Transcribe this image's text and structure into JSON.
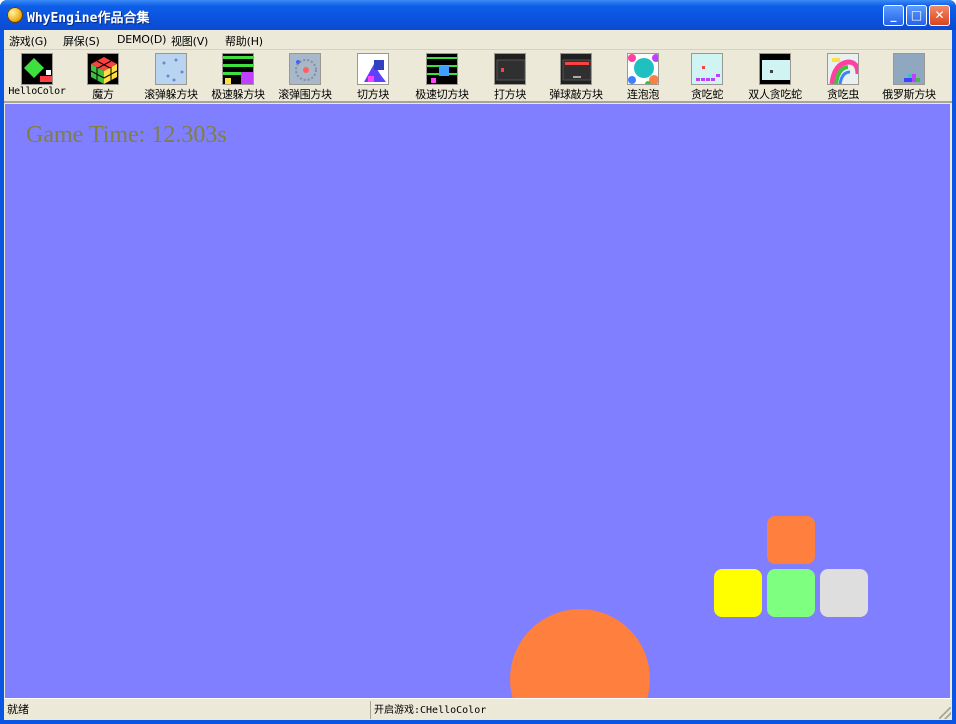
{
  "window": {
    "title": "WhyEngine作品合集",
    "minimize_label": "_",
    "maximize_label": "□",
    "close_label": "✕"
  },
  "menu": [
    {
      "label": "游戏(G)"
    },
    {
      "label": "屏保(S)"
    },
    {
      "label": "DEMO(D)"
    },
    {
      "label": "视图(V)"
    },
    {
      "label": "帮助(H)"
    }
  ],
  "toolbar": [
    {
      "label": "HelloColor",
      "icon": "hellocolor-icon"
    },
    {
      "label": "魔方",
      "icon": "rubiks-cube-icon"
    },
    {
      "label": "滚弹躲方块",
      "icon": "ball-dodge-icon"
    },
    {
      "label": "极速躲方块",
      "icon": "speed-dodge-icon"
    },
    {
      "label": "滚弹围方块",
      "icon": "ball-surround-icon"
    },
    {
      "label": "切方块",
      "icon": "cut-block-icon"
    },
    {
      "label": "极速切方块",
      "icon": "speed-cut-icon"
    },
    {
      "label": "打方块",
      "icon": "hit-block-icon"
    },
    {
      "label": "弹球敲方块",
      "icon": "breakout-icon"
    },
    {
      "label": "连泡泡",
      "icon": "bubbles-icon"
    },
    {
      "label": "贪吃蛇",
      "icon": "snake-icon"
    },
    {
      "label": "双人贪吃蛇",
      "icon": "two-player-snake-icon"
    },
    {
      "label": "贪吃虫",
      "icon": "worm-icon"
    },
    {
      "label": "俄罗斯方块",
      "icon": "tetris-icon"
    }
  ],
  "game": {
    "time_text": "Game Time: 12.303s",
    "background": "#7f7fff",
    "blocks": [
      {
        "name": "orange-block",
        "color": "#ff7f3f"
      },
      {
        "name": "yellow-block",
        "color": "#ffff00"
      },
      {
        "name": "green-block",
        "color": "#7fff7f"
      },
      {
        "name": "gray-block",
        "color": "#dedede"
      }
    ],
    "ball_color": "#ff7f3f"
  },
  "status": {
    "ready": "就绪",
    "message": "开启游戏:CHelloColor"
  }
}
